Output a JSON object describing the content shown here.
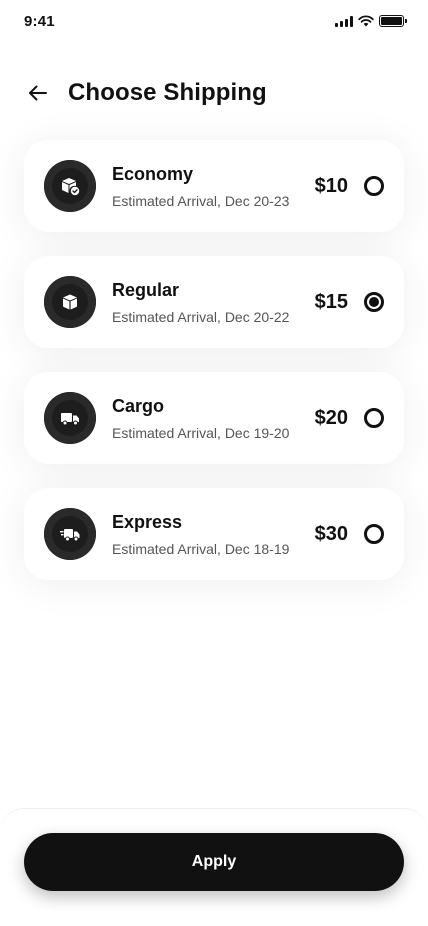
{
  "status_bar": {
    "time": "9:41",
    "icons": [
      "cellular-signal-icon",
      "wifi-icon",
      "battery-icon"
    ]
  },
  "header": {
    "back_icon": "arrow-left-icon",
    "title": "Choose Shipping"
  },
  "shipping_options": [
    {
      "name": "Economy",
      "eta": "Estimated Arrival, Dec 20-23",
      "price": "$10",
      "icon": "box-check-icon",
      "selected": false
    },
    {
      "name": "Regular",
      "eta": "Estimated Arrival, Dec 20-22",
      "price": "$15",
      "icon": "box-icon",
      "selected": true
    },
    {
      "name": "Cargo",
      "eta": "Estimated Arrival, Dec 19-20",
      "price": "$20",
      "icon": "truck-icon",
      "selected": false
    },
    {
      "name": "Express",
      "eta": "Estimated Arrival, Dec 18-19",
      "price": "$30",
      "icon": "fast-truck-icon",
      "selected": false
    }
  ],
  "footer": {
    "apply_label": "Apply"
  },
  "colors": {
    "primary": "#111111",
    "background": "#ffffff",
    "secondary_text": "#555555"
  }
}
